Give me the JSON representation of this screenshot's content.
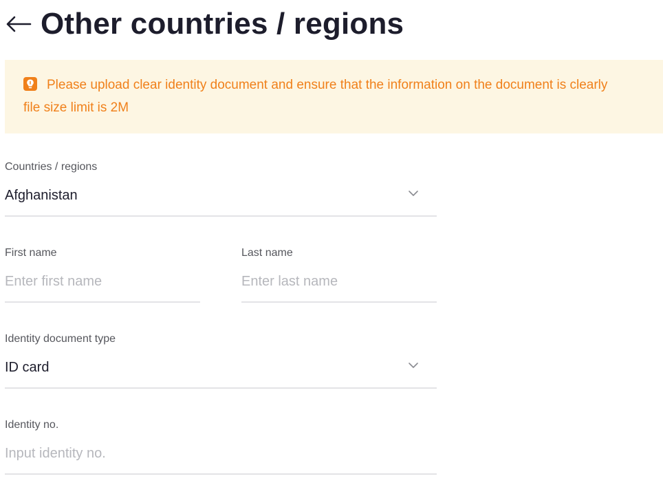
{
  "header": {
    "title": "Other countries / regions"
  },
  "notice": {
    "line1": "Please upload clear identity document and ensure that the information on the document is clearly",
    "line2": "file size limit is 2M",
    "color": "#f0801a",
    "background": "#fdf6e3"
  },
  "form": {
    "country": {
      "label": "Countries / regions",
      "value": "Afghanistan"
    },
    "first_name": {
      "label": "First name",
      "placeholder": "Enter first name"
    },
    "last_name": {
      "label": "Last name",
      "placeholder": "Enter last name"
    },
    "doc_type": {
      "label": "Identity document type",
      "value": "ID card"
    },
    "identity_no": {
      "label": "Identity no.",
      "placeholder": "Input identity no."
    }
  },
  "icons": {
    "back": "arrow-left-icon",
    "notice": "lightbulb-icon",
    "dropdown": "chevron-down-icon"
  }
}
